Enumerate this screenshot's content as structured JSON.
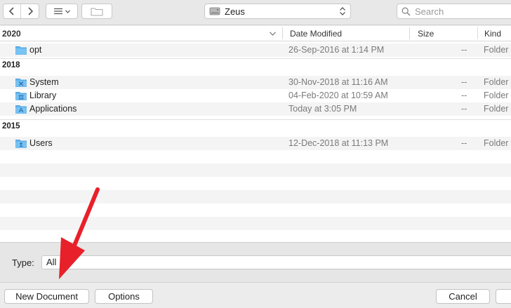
{
  "toolbar": {
    "location_label": "Zeus",
    "search_placeholder": "Search"
  },
  "columns": {
    "name_header": "2020",
    "date_header": "Date Modified",
    "size_header": "Size",
    "kind_header": "Kind"
  },
  "groups": [
    {
      "label": "2020",
      "rows": [
        {
          "name": "opt",
          "date": "26-Sep-2016 at 1:14 PM",
          "size": "--",
          "kind": "Folder",
          "icon": "folder-icon"
        }
      ]
    },
    {
      "label": "2018",
      "rows": [
        {
          "name": "System",
          "date": "30-Nov-2018 at 11:16 AM",
          "size": "--",
          "kind": "Folder",
          "icon": "system-folder-icon"
        },
        {
          "name": "Library",
          "date": "04-Feb-2020 at 10:59 AM",
          "size": "--",
          "kind": "Folder",
          "icon": "library-folder-icon"
        },
        {
          "name": "Applications",
          "date": "Today at 3:05 PM",
          "size": "--",
          "kind": "Folder",
          "icon": "applications-folder-icon"
        }
      ]
    },
    {
      "label": "2015",
      "rows": [
        {
          "name": "Users",
          "date": "12-Dec-2018 at 11:13 PM",
          "size": "--",
          "kind": "Folder",
          "icon": "users-folder-icon"
        }
      ]
    }
  ],
  "type_bar": {
    "label": "Type:",
    "value": "All"
  },
  "buttons": {
    "new_document": "New Document",
    "options": "Options",
    "cancel": "Cancel"
  },
  "colors": {
    "folder_blue": "#5fb4ef",
    "annotation_red": "#e8202a"
  }
}
